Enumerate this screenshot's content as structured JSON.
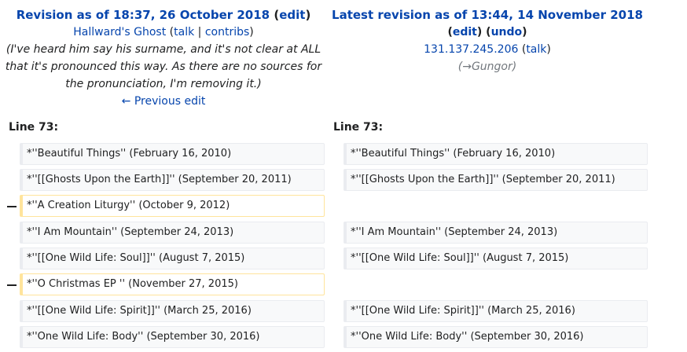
{
  "left": {
    "title_prefix": "Revision as of 18:37, 26 October 2018",
    "edit_label": "edit",
    "user": "Hallward's Ghost",
    "talk_label": "talk",
    "contribs_label": "contribs",
    "summary_lines": [
      "(I've heard him say his surname, and it's not clear at ALL",
      "that it's pronounced this way. As there are no sources for",
      "the pronunciation, I'm removing it.)"
    ],
    "prev_edit": "← Previous edit",
    "line_no": "Line 73:"
  },
  "right": {
    "title_prefix": "Latest revision as of 13:44, 14 November 2018",
    "edit_label": "edit",
    "undo_label": "undo",
    "user": "131.137.245.206",
    "talk_label": "talk",
    "summary_arrow": "→",
    "summary_section": "Gungor",
    "line_no": "Line 73:"
  },
  "diff_rows": [
    {
      "left": "*''Beautiful Things'' (February 16, 2010)",
      "right": "*''Beautiful Things'' (February 16, 2010)",
      "deleted": false
    },
    {
      "left": "*''[[Ghosts Upon the Earth]]'' (September 20, 2011)",
      "right": "*''[[Ghosts Upon the Earth]]'' (September 20, 2011)",
      "deleted": false
    },
    {
      "left": "*''A Creation Liturgy'' (October 9, 2012)",
      "right": "",
      "deleted": true
    },
    {
      "left": "*''I Am Mountain'' (September 24, 2013)",
      "right": "*''I Am Mountain'' (September 24, 2013)",
      "deleted": false
    },
    {
      "left": "*''[[One Wild Life: Soul]]'' (August 7, 2015)",
      "right": "*''[[One Wild Life: Soul]]'' (August 7, 2015)",
      "deleted": false
    },
    {
      "left": "*''O Christmas EP '' (November 27, 2015)",
      "right": "",
      "deleted": true
    },
    {
      "left": "*''[[One Wild Life: Spirit]]''  (March 25, 2016)",
      "right": "*''[[One Wild Life: Spirit]]''  (March 25, 2016)",
      "deleted": false
    },
    {
      "left": "*''One Wild Life: Body''  (September 30, 2016)",
      "right": "*''One Wild Life: Body''  (September 30, 2016)",
      "deleted": false
    }
  ]
}
